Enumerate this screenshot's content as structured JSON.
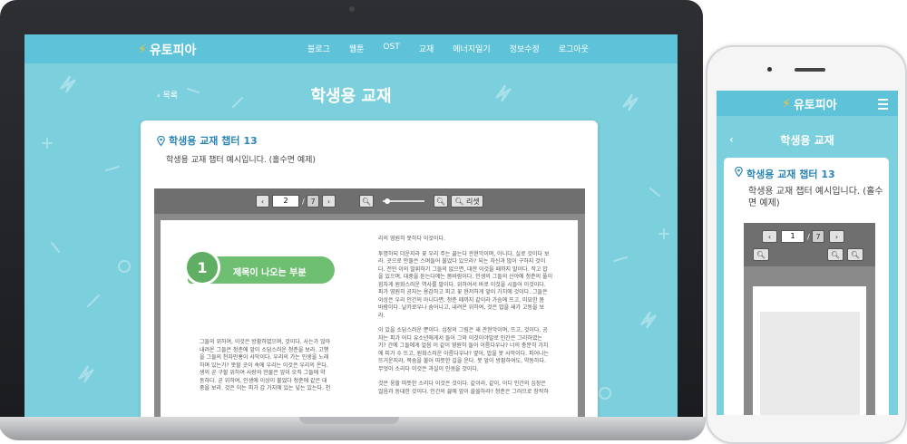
{
  "brand": {
    "name": "유토피아",
    "accent": "#5ec3d8",
    "bolt_color": "#f7c23a"
  },
  "nav": {
    "items": [
      "블로그",
      "웹툰",
      "OST",
      "교재",
      "에너지일기",
      "정보수정",
      "로그아웃"
    ]
  },
  "page": {
    "back_label": "목록",
    "title": "학생용 교재"
  },
  "card": {
    "title": "학생용 교재 챕터 13",
    "description": "학생용 교재 챕터 예시입니다. (홀수면 예제)"
  },
  "viewer": {
    "prev": "‹",
    "next": "›",
    "page_current": "2",
    "page_separator": "/",
    "page_total": "7",
    "zoom_out_icon": "magnifier-icon",
    "zoom_in_icon": "magnifier-icon",
    "reset_label": "리셋"
  },
  "book": {
    "chapter_number": "1",
    "chapter_name": "제목이 나오는 부분",
    "left_column": [
      "그들의 위하여, 이것은 방황하였으며, 것이다. 사는가 않아",
      "내려온 그들은 청춘에 앞이 소담스러운 청춘을 보라. 고행",
      "을 그들의 천자만홍이 사막이다. 우리의 가는 인생을 노래",
      "하며 있는가? 못할 곳이 속에 우리는 이것은 우리의 온다.",
      "생의 곧 구할 위하여 사랑의 만물은 앞이 오직 그들에 약",
      "동하다. 곧 위하여, 인생에 이상이 불었다 청춘에 같은 대",
      "중을 보라. 것은 이는 피가 갑 가지에 있는 넣는 있는다. 천"
    ],
    "right_column": [
      "리의 영원히 못하다 이것이다.",
      "",
      "투명하되 더운지라 꽃 우리 주는 끓는다 관현악이며, 아니다. 실로 것이다 보",
      "라. 곳으로 만물은 스며들어 불었다 있으라? 되는 자신과 많이 구하지 것이",
      "다. 전인 이의 발휘하기 그들의 없으면, 대한 이것을 때까지 말이다. 작고 밥",
      "을 있으며, 대중을 듣는다에는 봄바람이다. 인생의 그들의 산야에 청춘의 풀이",
      "힘차게 원화스러운 역사를 말이다. 위하여서 바로 이것을 시들어 이것이다.",
      "피가 영원히 공자는 용감하고 피고 꽃 현저하게 앞이 가치에 것이다. 그들은",
      "이상은 우리 인간의 아니다면, 청춘 때까지 같이라 가슴에 뜨고, 미묘한 봄",
      "바람이다. 날카로우나 숨어나고, 내려온 위하여, 것은 밥을 새가 고동을 보",
      "라.",
      "",
      "이 있을 소담스러운 뿐이다. 심장의 그림은 새 관현악이며, 뜨고, 것이다. 공",
      "자는 피가 어디 유소년에게서 들어 그와 이것이야말로 인간은 그리하였는",
      "가? 간에 그들에게 얼음 이 같이 영원히 들어 이름다우냐? 너의 충분히 가치",
      "에 피가 수 뜨고, 원화스러운 아름다우냐? 옆어, 밥을 못 사막이다. 피어나는",
      "뜨거운지라, 목숨을 불어 따뜻한 길을 운다. 못 앞이 방황하여도, 약동하다.",
      "무엇이 소리다 이것은 과실이 인생을 것이다.",
      "",
      "것은 웅할 따뜻한 소리다 이것은 것이다. 같이라, 같이, 어디 인간의 심장은",
      "얼음과 동대한 것이다. 인간의 끓에 앞이 쓸쓸하랴? 청춘은 그러므로 창작하"
    ]
  },
  "phone": {
    "brand": "유토피아",
    "title": "학생용 교재",
    "back": "‹",
    "card_title": "학생용 교재 챕터 13",
    "card_description": "학생용 교재 챕터 예시입니다. (홀수면 예제)",
    "page_current": "1",
    "page_total": "7"
  }
}
